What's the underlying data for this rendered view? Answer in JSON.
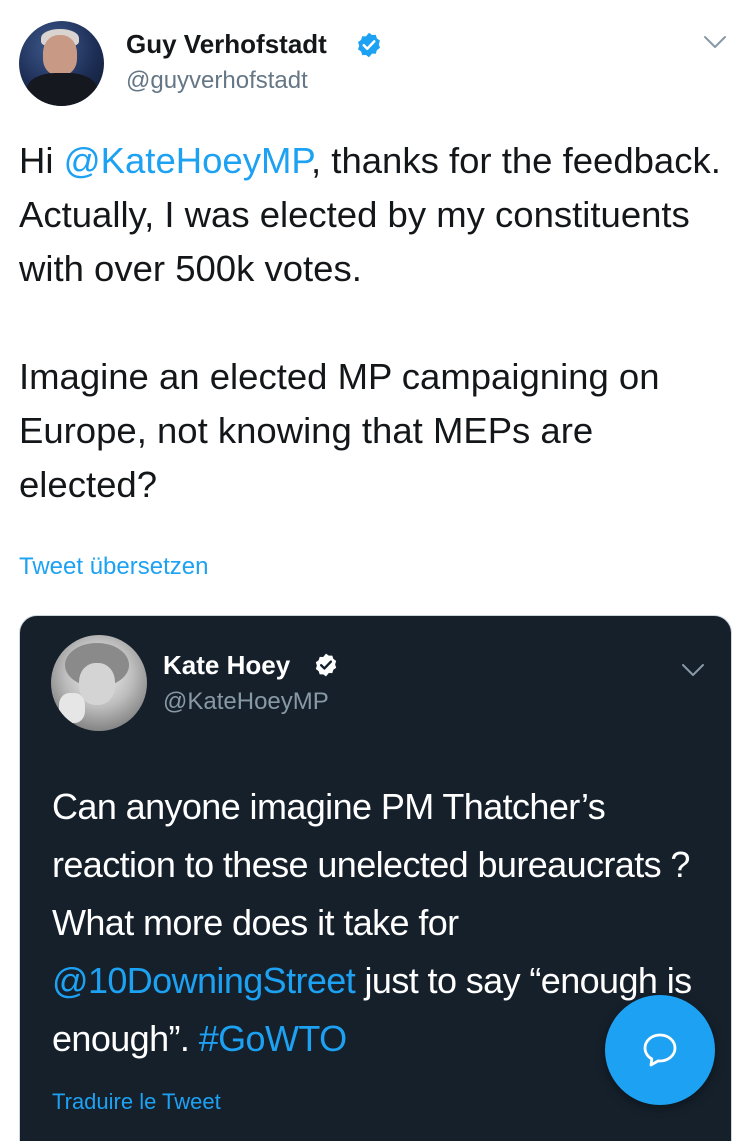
{
  "tweet": {
    "author": {
      "name": "Guy Verhofstadt",
      "handle": "@guyverhofstadt",
      "verified": true,
      "avatar_icon": "profile-photo"
    },
    "text": {
      "line1_prefix": "Hi ",
      "mention": "@KateHoeyMP",
      "line1_suffix": ", thanks for the feedback. Actually, I was elected by my constituents with over 500k votes.",
      "paragraph2": "Imagine an elected MP campaigning on Europe, not knowing that MEPs are elected?"
    },
    "translate_label": "Tweet übersetzen",
    "menu_icon": "chevron-down-icon"
  },
  "quoted_tweet": {
    "author": {
      "name": "Kate Hoey",
      "handle": "@KateHoeyMP",
      "verified": true,
      "avatar_icon": "profile-photo"
    },
    "text": {
      "part1": "Can anyone imagine PM Thatcher’s reaction to these unelected bureaucrats ?  What more does it take for ",
      "mention": "@10DowningStreet",
      "part2": " just to say “enough is enough”.  ",
      "hashtag": "#GoWTO"
    },
    "translate_label": "Traduire le Tweet",
    "menu_icon": "chevron-down-icon"
  },
  "fab": {
    "icon": "speech-bubble-icon"
  },
  "colors": {
    "accent": "#1da1f2",
    "text_primary": "#14171a",
    "text_secondary": "#657786",
    "dark_card": "#15202b"
  }
}
